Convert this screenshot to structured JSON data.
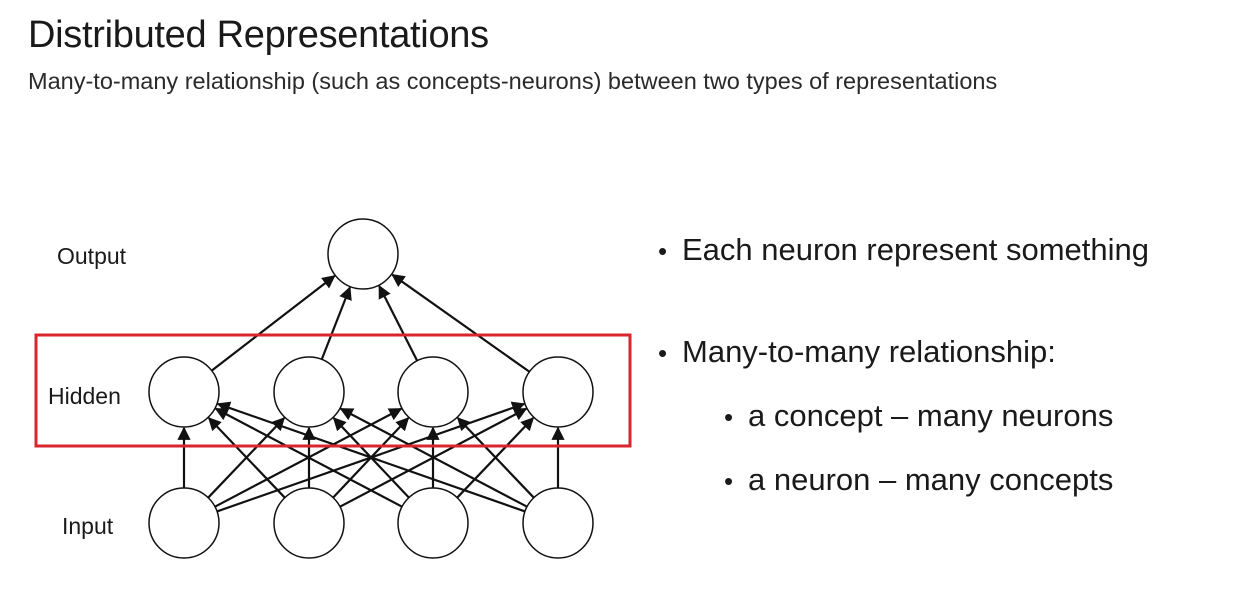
{
  "slide": {
    "title": "Distributed Representations",
    "subtitle": "Many-to-many relationship (such as concepts-neurons) between two types of representations"
  },
  "diagram": {
    "layers": {
      "output": "Output",
      "hidden": "Hidden",
      "input": "Input"
    },
    "highlight_color": "#d9262c"
  },
  "bullets": {
    "items": [
      {
        "text": "Each neuron represent something",
        "level": 1
      },
      {
        "text": "Many-to-many relationship:",
        "level": 1
      },
      {
        "text": "a concept – many neurons",
        "level": 2
      },
      {
        "text": "a neuron – many concepts",
        "level": 2
      }
    ]
  }
}
